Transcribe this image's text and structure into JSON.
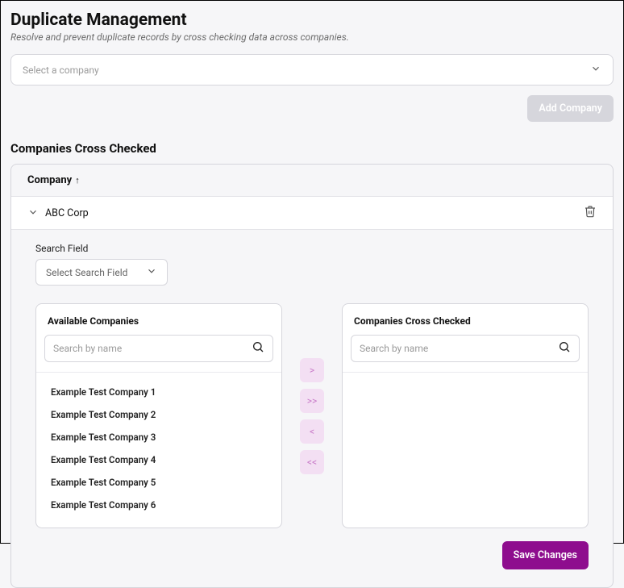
{
  "header": {
    "title": "Duplicate Management",
    "subtitle": "Resolve and prevent duplicate records by cross checking data across companies."
  },
  "company_select": {
    "placeholder": "Select a company"
  },
  "buttons": {
    "add_company": "Add Company",
    "save": "Save Changes"
  },
  "section_title": "Companies Cross Checked",
  "grid": {
    "header_col": "Company",
    "sort_arrow": "↑",
    "row_name": "ABC Corp"
  },
  "search_field": {
    "label": "Search Field",
    "placeholder": "Select Search Field"
  },
  "available": {
    "title": "Available Companies",
    "search_placeholder": "Search by name",
    "items": [
      "Example Test Company 1",
      "Example Test Company 2",
      "Example Test Company 3",
      "Example Test Company 4",
      "Example Test Company 5",
      "Example Test Company 6"
    ]
  },
  "checked": {
    "title": "Companies Cross Checked",
    "search_placeholder": "Search by name"
  },
  "transfer": {
    "right": ">",
    "right_all": ">>",
    "left": "<",
    "left_all": "<<"
  }
}
